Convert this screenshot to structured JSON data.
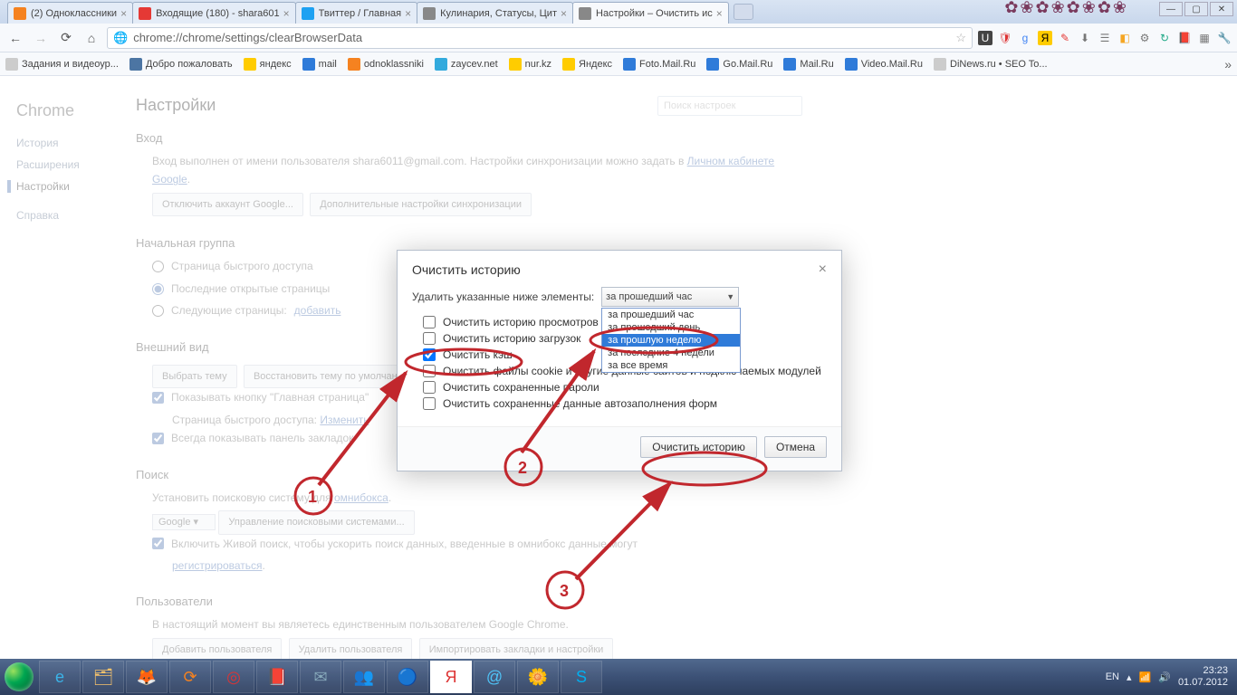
{
  "tabs": [
    {
      "title": "(2) Одноклассники",
      "fav": "#f58220"
    },
    {
      "title": "Входящие (180) - shara601",
      "fav": "#e53935"
    },
    {
      "title": "Твиттер / Главная",
      "fav": "#1da1f2"
    },
    {
      "title": "Кулинария, Статусы, Цит",
      "fav": "#888"
    },
    {
      "title": "Настройки – Очистить ис",
      "fav": "#888",
      "active": true
    }
  ],
  "url": "chrome://chrome/settings/clearBrowserData",
  "bookmarks": [
    {
      "label": "Задания и видеоур...",
      "c": "#ccc"
    },
    {
      "label": "Добро пожаловать",
      "c": "#4c75a3"
    },
    {
      "label": "яндекс",
      "c": "#ffcc00"
    },
    {
      "label": "mail",
      "c": "#2f7bd9"
    },
    {
      "label": "odnoklassniki",
      "c": "#f58220"
    },
    {
      "label": "zaycev.net",
      "c": "#33aadd"
    },
    {
      "label": "nur.kz",
      "c": "#ffcc00"
    },
    {
      "label": "Яндекс",
      "c": "#ffcc00"
    },
    {
      "label": "Foto.Mail.Ru",
      "c": "#2f7bd9"
    },
    {
      "label": "Go.Mail.Ru",
      "c": "#2f7bd9"
    },
    {
      "label": "Mail.Ru",
      "c": "#2f7bd9"
    },
    {
      "label": "Video.Mail.Ru",
      "c": "#2f7bd9"
    },
    {
      "label": "DiNews.ru • SEO To...",
      "c": "#ccc"
    }
  ],
  "sidebar": {
    "brand": "Chrome",
    "items": [
      "История",
      "Расширения",
      "Настройки"
    ],
    "help": "Справка"
  },
  "settings_title": "Настройки",
  "search_placeholder": "Поиск настроек",
  "login": {
    "heading": "Вход",
    "text1": "Вход выполнен от имени пользователя shara6011@gmail.com. Настройки синхронизации можно задать в ",
    "link": "Личном кабинете Google",
    "btn1": "Отключить аккаунт Google...",
    "btn2": "Дополнительные настройки синхронизации"
  },
  "startup": {
    "heading": "Начальная группа",
    "opt1": "Страница быстрого доступа",
    "opt2": "Последние открытые страницы",
    "opt3": "Следующие страницы:",
    "add": "добавить"
  },
  "appearance": {
    "heading": "Внешний вид",
    "btn1": "Выбрать тему",
    "btn2": "Восстановить тему по умолчанию",
    "chk1": "Показывать кнопку \"Главная страница\"",
    "quick": "Страница быстрого доступа:",
    "change": "Изменить",
    "chk2": "Всегда показывать панель закладок"
  },
  "search": {
    "heading": "Поиск",
    "text": "Установить поисковую систему для ",
    "omnibox": "омнибокса",
    "engine": "Google",
    "btn": "Управление поисковыми системами...",
    "chk": "Включить Живой поиск, чтобы ускорить поиск данных, введенные в омнибокс данные могут ",
    "reg": "регистрироваться"
  },
  "users": {
    "heading": "Пользователи",
    "text": "В настоящий момент вы являетесь единственным пользователем Google Chrome.",
    "btn1": "Добавить пользователя",
    "btn2": "Удалить пользователя",
    "btn3": "Импортировать закладки и настройки"
  },
  "modal": {
    "title": "Очистить историю",
    "label": "Удалить указанные ниже элементы:",
    "selected": "за прошедший час",
    "options": [
      "за прошедший час",
      "за прошедший день",
      "за прошлую неделю",
      "за последние 4 недели",
      "за все время"
    ],
    "c1": "Очистить историю просмотров",
    "c2": "Очистить историю загрузок",
    "c3": "Очистить кэш",
    "c4": "Очистить файлы cookie и другие данные сайтов и подключаемых модулей",
    "c5": "Очистить сохраненные пароли",
    "c6": "Очистить сохраненные данные автозаполнения форм",
    "ok": "Очистить историю",
    "cancel": "Отмена"
  },
  "tray": {
    "lang": "EN",
    "time": "23:23",
    "date": "01.07.2012"
  },
  "anno": {
    "n1": "1",
    "n2": "2",
    "n3": "3"
  }
}
